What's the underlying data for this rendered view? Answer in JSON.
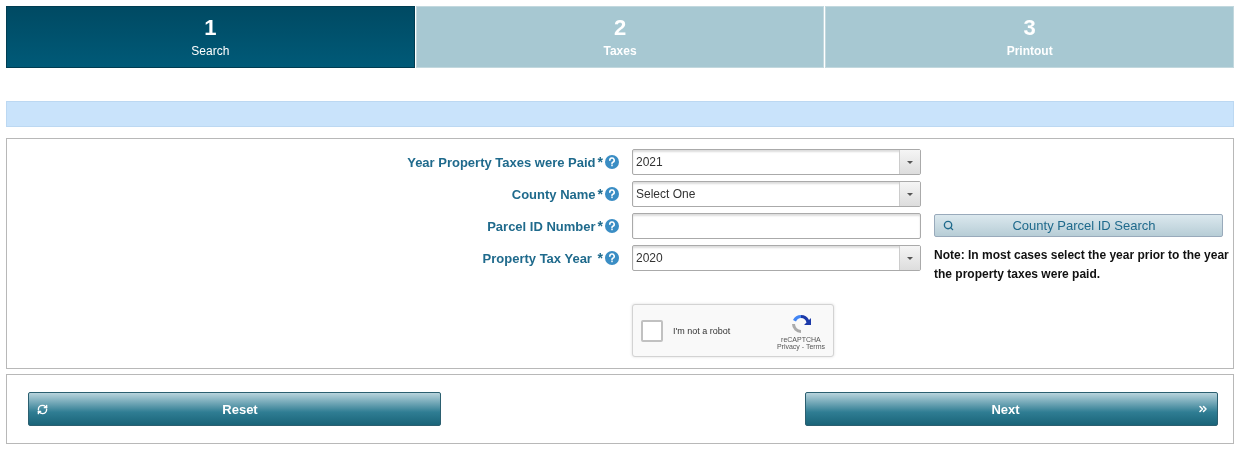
{
  "steps": [
    {
      "number": "1",
      "label": "Search",
      "selected": true
    },
    {
      "number": "2",
      "label": "Taxes",
      "selected": false
    },
    {
      "number": "3",
      "label": "Printout",
      "selected": false
    }
  ],
  "fields": [
    {
      "kind": "select",
      "label": "Year Property Taxes were Paid",
      "required": "*",
      "value": "2021"
    },
    {
      "kind": "select",
      "label": "County Name",
      "required": "*",
      "value": "Select One"
    },
    {
      "kind": "text",
      "label": "Parcel ID Number",
      "required": "*",
      "side_button": "County Parcel ID Search"
    },
    {
      "kind": "select",
      "label": "Property Tax Year ",
      "required": "*",
      "value": "2020",
      "note": "Note: In most cases select the year prior to the year the property taxes were paid."
    }
  ],
  "captcha": {
    "label": "I'm not a robot",
    "checked": false,
    "brand": "reCAPTCHA",
    "links": "Privacy - Terms"
  },
  "buttons": [
    {
      "kind": "reset",
      "label": "Reset"
    },
    {
      "kind": "next",
      "label": "Next"
    }
  ]
}
